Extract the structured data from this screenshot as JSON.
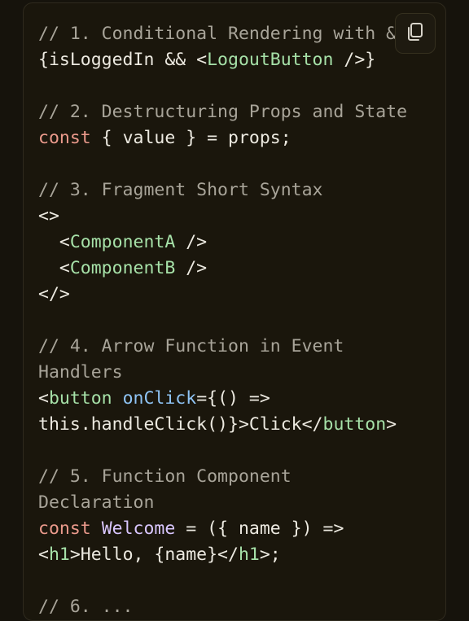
{
  "colors": {
    "background": "#16130c",
    "card": "#1a160c",
    "comment": "#a8a499",
    "plain": "#ece9e0",
    "keyword": "#eb9a8c",
    "tag": "#a6e1a8",
    "attribute": "#8fc4f5",
    "component_name": "#d9c6ff"
  },
  "copy_button": {
    "icon": "copy-icon"
  },
  "code": {
    "lines": [
      [
        {
          "t": "// 1. Conditional Rendering with &&",
          "c": "comment"
        }
      ],
      [
        {
          "t": "{isLoggedIn && <",
          "c": "plain"
        },
        {
          "t": "LogoutButton",
          "c": "tag"
        },
        {
          "t": " />}",
          "c": "plain"
        }
      ],
      [],
      [
        {
          "t": "// 2. Destructuring Props and State",
          "c": "comment"
        }
      ],
      [
        {
          "t": "const",
          "c": "keyword"
        },
        {
          "t": " { value } = props;",
          "c": "plain"
        }
      ],
      [],
      [
        {
          "t": "// 3. Fragment Short Syntax",
          "c": "comment"
        }
      ],
      [
        {
          "t": "<>",
          "c": "plain"
        }
      ],
      [
        {
          "t": "  <",
          "c": "plain"
        },
        {
          "t": "ComponentA",
          "c": "tag"
        },
        {
          "t": " />",
          "c": "plain"
        }
      ],
      [
        {
          "t": "  <",
          "c": "plain"
        },
        {
          "t": "ComponentB",
          "c": "tag"
        },
        {
          "t": " />",
          "c": "plain"
        }
      ],
      [
        {
          "t": "</>",
          "c": "plain"
        }
      ],
      [],
      [
        {
          "t": "// 4. Arrow Function in Event",
          "c": "comment"
        }
      ],
      [
        {
          "t": "Handlers",
          "c": "comment"
        }
      ],
      [
        {
          "t": "<",
          "c": "plain"
        },
        {
          "t": "button",
          "c": "tag"
        },
        {
          "t": " ",
          "c": "plain"
        },
        {
          "t": "onClick",
          "c": "attr"
        },
        {
          "t": "={() =>",
          "c": "plain"
        }
      ],
      [
        {
          "t": "this.handleClick()}>Click</",
          "c": "plain"
        },
        {
          "t": "button",
          "c": "tag"
        },
        {
          "t": ">",
          "c": "plain"
        }
      ],
      [],
      [
        {
          "t": "// 5. Function Component",
          "c": "comment"
        }
      ],
      [
        {
          "t": "Declaration",
          "c": "comment"
        }
      ],
      [
        {
          "t": "const",
          "c": "keyword"
        },
        {
          "t": " ",
          "c": "plain"
        },
        {
          "t": "Welcome",
          "c": "name"
        },
        {
          "t": " = ({ name }) =>",
          "c": "plain"
        }
      ],
      [
        {
          "t": "<",
          "c": "plain"
        },
        {
          "t": "h1",
          "c": "tag"
        },
        {
          "t": ">Hello, {name}</",
          "c": "plain"
        },
        {
          "t": "h1",
          "c": "tag"
        },
        {
          "t": ">;",
          "c": "plain"
        }
      ],
      [],
      [
        {
          "t": "// 6. ...",
          "c": "comment"
        }
      ]
    ]
  }
}
